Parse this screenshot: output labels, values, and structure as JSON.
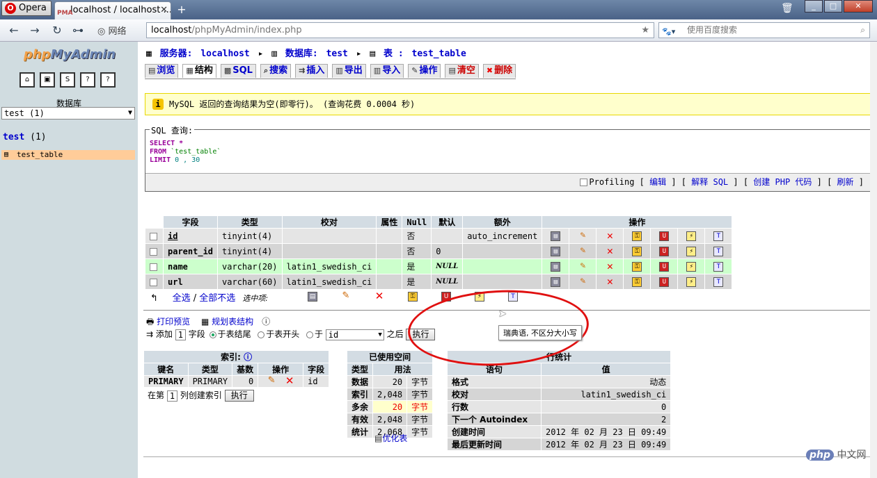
{
  "browser": {
    "app_name": "Opera",
    "tab_title": "localhost / localhost ...",
    "network_label": "网络",
    "url_host": "localhost",
    "url_path": "/phpMyAdmin/index.php",
    "search_placeholder": "使用百度搜索"
  },
  "sidebar": {
    "logo_php": "php",
    "logo_my": "MyAdmin",
    "db_label": "数据库",
    "db_selected": "test (1)",
    "db_link_name": "test",
    "db_link_count": "(1)",
    "table_item": "test_table",
    "icons": [
      "home-icon",
      "exit-icon",
      "sql-icon",
      "query-window-icon",
      "docs-icon"
    ]
  },
  "breadcrumb": {
    "server_label": "服务器:",
    "server": "localhost",
    "db_label": "数据库:",
    "db": "test",
    "table_label": "表 :",
    "table": "test_table"
  },
  "tabs": [
    {
      "label": "浏览",
      "icon": "browse"
    },
    {
      "label": "结构",
      "icon": "structure",
      "active": true
    },
    {
      "label": "SQL",
      "icon": "sql"
    },
    {
      "label": "搜索",
      "icon": "search"
    },
    {
      "label": "插入",
      "icon": "insert"
    },
    {
      "label": "导出",
      "icon": "export"
    },
    {
      "label": "导入",
      "icon": "import"
    },
    {
      "label": "操作",
      "icon": "operations"
    },
    {
      "label": "清空",
      "icon": "empty",
      "danger": true
    },
    {
      "label": "删除",
      "icon": "drop",
      "danger": true
    }
  ],
  "notice": "MySQL 返回的查询结果为空(即零行)。 (查询花费 0.0004 秒)",
  "sql_query": {
    "legend": "SQL 查询:",
    "line1_kw": "SELECT",
    "line1_rest": " *",
    "line2_kw": "FROM",
    "line2_rest": " `test_table`",
    "line3_kw": "LIMIT",
    "line3_rest": " 0 , 30",
    "profiling": "Profiling",
    "links": [
      "编辑",
      "解释 SQL",
      "创建 PHP 代码",
      "刷新"
    ]
  },
  "fields_table": {
    "headers": [
      "字段",
      "类型",
      "校对",
      "属性",
      "Null",
      "默认",
      "额外",
      "操作"
    ],
    "rows": [
      {
        "name": "id",
        "type": "tinyint(4)",
        "collation": "",
        "attributes": "",
        "null": "否",
        "default": "",
        "extra": "auto_increment",
        "style": "odd",
        "primary": true
      },
      {
        "name": "parent_id",
        "type": "tinyint(4)",
        "collation": "",
        "attributes": "",
        "null": "否",
        "default": "0",
        "extra": "",
        "style": "even"
      },
      {
        "name": "name",
        "type": "varchar(20)",
        "collation": "latin1_swedish_ci",
        "attributes": "",
        "null": "是",
        "default": "NULL",
        "extra": "",
        "style": "hl"
      },
      {
        "name": "url",
        "type": "varchar(60)",
        "collation": "latin1_swedish_ci",
        "attributes": "",
        "null": "是",
        "default": "NULL",
        "extra": "",
        "style": "even"
      }
    ]
  },
  "with_selected": {
    "check_all": "全选",
    "separator": "/",
    "uncheck_all": "全部不选",
    "label": "选中项:"
  },
  "tooltip": "瑞典语, 不区分大小写",
  "print_view": "打印预览",
  "propose_structure": "规划表结构",
  "add_field": {
    "label": "添加",
    "count": "1",
    "unit": "字段",
    "opt_end": "于表结尾",
    "opt_begin": "于表开头",
    "opt_after": "于",
    "after_field": "id",
    "after_label": "之后",
    "go": "执行"
  },
  "indexes": {
    "title": "索引:",
    "headers": [
      "键名",
      "类型",
      "基数",
      "操作",
      "字段"
    ],
    "rows": [
      {
        "key": "PRIMARY",
        "type": "PRIMARY",
        "cardinality": "0",
        "field": "id"
      }
    ],
    "create_prefix": "在第",
    "create_count": "1",
    "create_suffix": "列创建索引",
    "go": "执行"
  },
  "space": {
    "title": "已使用空间",
    "headers": [
      "类型",
      "用法"
    ],
    "rows": [
      {
        "type": "数据",
        "value": "20",
        "unit": "字节"
      },
      {
        "type": "索引",
        "value": "2,048",
        "unit": "字节"
      },
      {
        "type": "多余",
        "value": "20",
        "unit": "字节",
        "warn": true
      },
      {
        "type": "有效",
        "value": "2,048",
        "unit": "字节"
      },
      {
        "type": "统计",
        "value": "2,068",
        "unit": "字节"
      }
    ],
    "optimize": "优化表"
  },
  "row_stats": {
    "title": "行统计",
    "headers": [
      "语句",
      "值"
    ],
    "rows": [
      {
        "label": "格式",
        "value": "动态"
      },
      {
        "label": "校对",
        "value": "latin1_swedish_ci"
      },
      {
        "label": "行数",
        "value": "0"
      },
      {
        "label": "下一个 Autoindex",
        "value": "2"
      },
      {
        "label": "创建时间",
        "value": "2012 年 02 月 23 日 09:49"
      },
      {
        "label": "最后更新时间",
        "value": "2012 年 02 月 23 日 09:49"
      }
    ]
  },
  "watermark": {
    "badge": "php",
    "text": "中文网"
  }
}
